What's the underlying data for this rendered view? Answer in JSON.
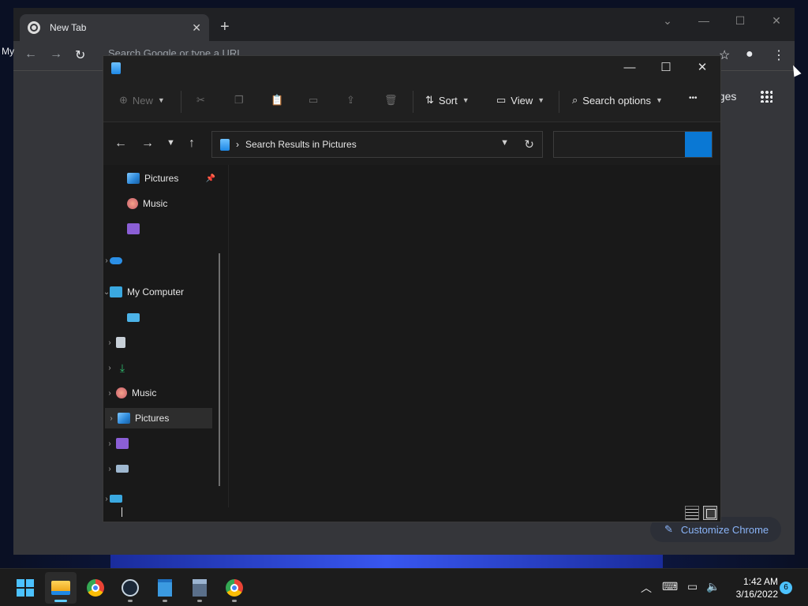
{
  "chrome": {
    "tab_title": "New Tab",
    "tab_close": "✕",
    "new_tab": "+",
    "omnibox_placeholder": "Search Google or type a URL",
    "my_label": "My",
    "images_label": "ages",
    "customize_label": "Customize Chrome",
    "controls": {
      "minimize": "—",
      "maximize": "☐",
      "close": "✕",
      "dropdown": "⌄"
    }
  },
  "explorer": {
    "cmdbar": {
      "new_label": "New",
      "sort_label": "Sort",
      "view_label": "View",
      "search_options_label": "Search options",
      "more": "•••"
    },
    "address": {
      "breadcrumb": "Search Results in Pictures",
      "separator": "›"
    },
    "search": {
      "value": ""
    },
    "nav": [
      {
        "label": "Pictures",
        "icon": "pictures-icon",
        "expander": "",
        "pinned": true
      },
      {
        "label": "Music",
        "icon": "music-icon",
        "expander": "",
        "pinned": false
      },
      {
        "label": "",
        "icon": "videos-icon",
        "expander": "",
        "pinned": false
      },
      {
        "label": "",
        "icon": "onedrive-icon",
        "expander": "›",
        "pinned": false
      },
      {
        "label": "My Computer",
        "icon": "computer-icon",
        "expander": "⌄",
        "pinned": false
      },
      {
        "label": "",
        "icon": "drive-icon",
        "expander": "",
        "pinned": false
      },
      {
        "label": "",
        "icon": "documents-icon",
        "expander": "›",
        "pinned": false
      },
      {
        "label": "",
        "icon": "downloads-icon",
        "expander": "›",
        "pinned": false
      },
      {
        "label": "Music",
        "icon": "music-icon",
        "expander": "›",
        "pinned": false
      },
      {
        "label": "Pictures",
        "icon": "pictures-icon",
        "expander": "›",
        "pinned": false,
        "selected": true
      },
      {
        "label": "",
        "icon": "videos-icon",
        "expander": "›",
        "pinned": false
      },
      {
        "label": "",
        "icon": "disk-icon",
        "expander": "›",
        "pinned": false
      },
      {
        "label": "",
        "icon": "network-icon",
        "expander": "›",
        "pinned": false
      }
    ]
  },
  "taskbar": {
    "clock_time": "1:42 AM",
    "clock_date": "3/16/2022",
    "notification_count": "6"
  }
}
